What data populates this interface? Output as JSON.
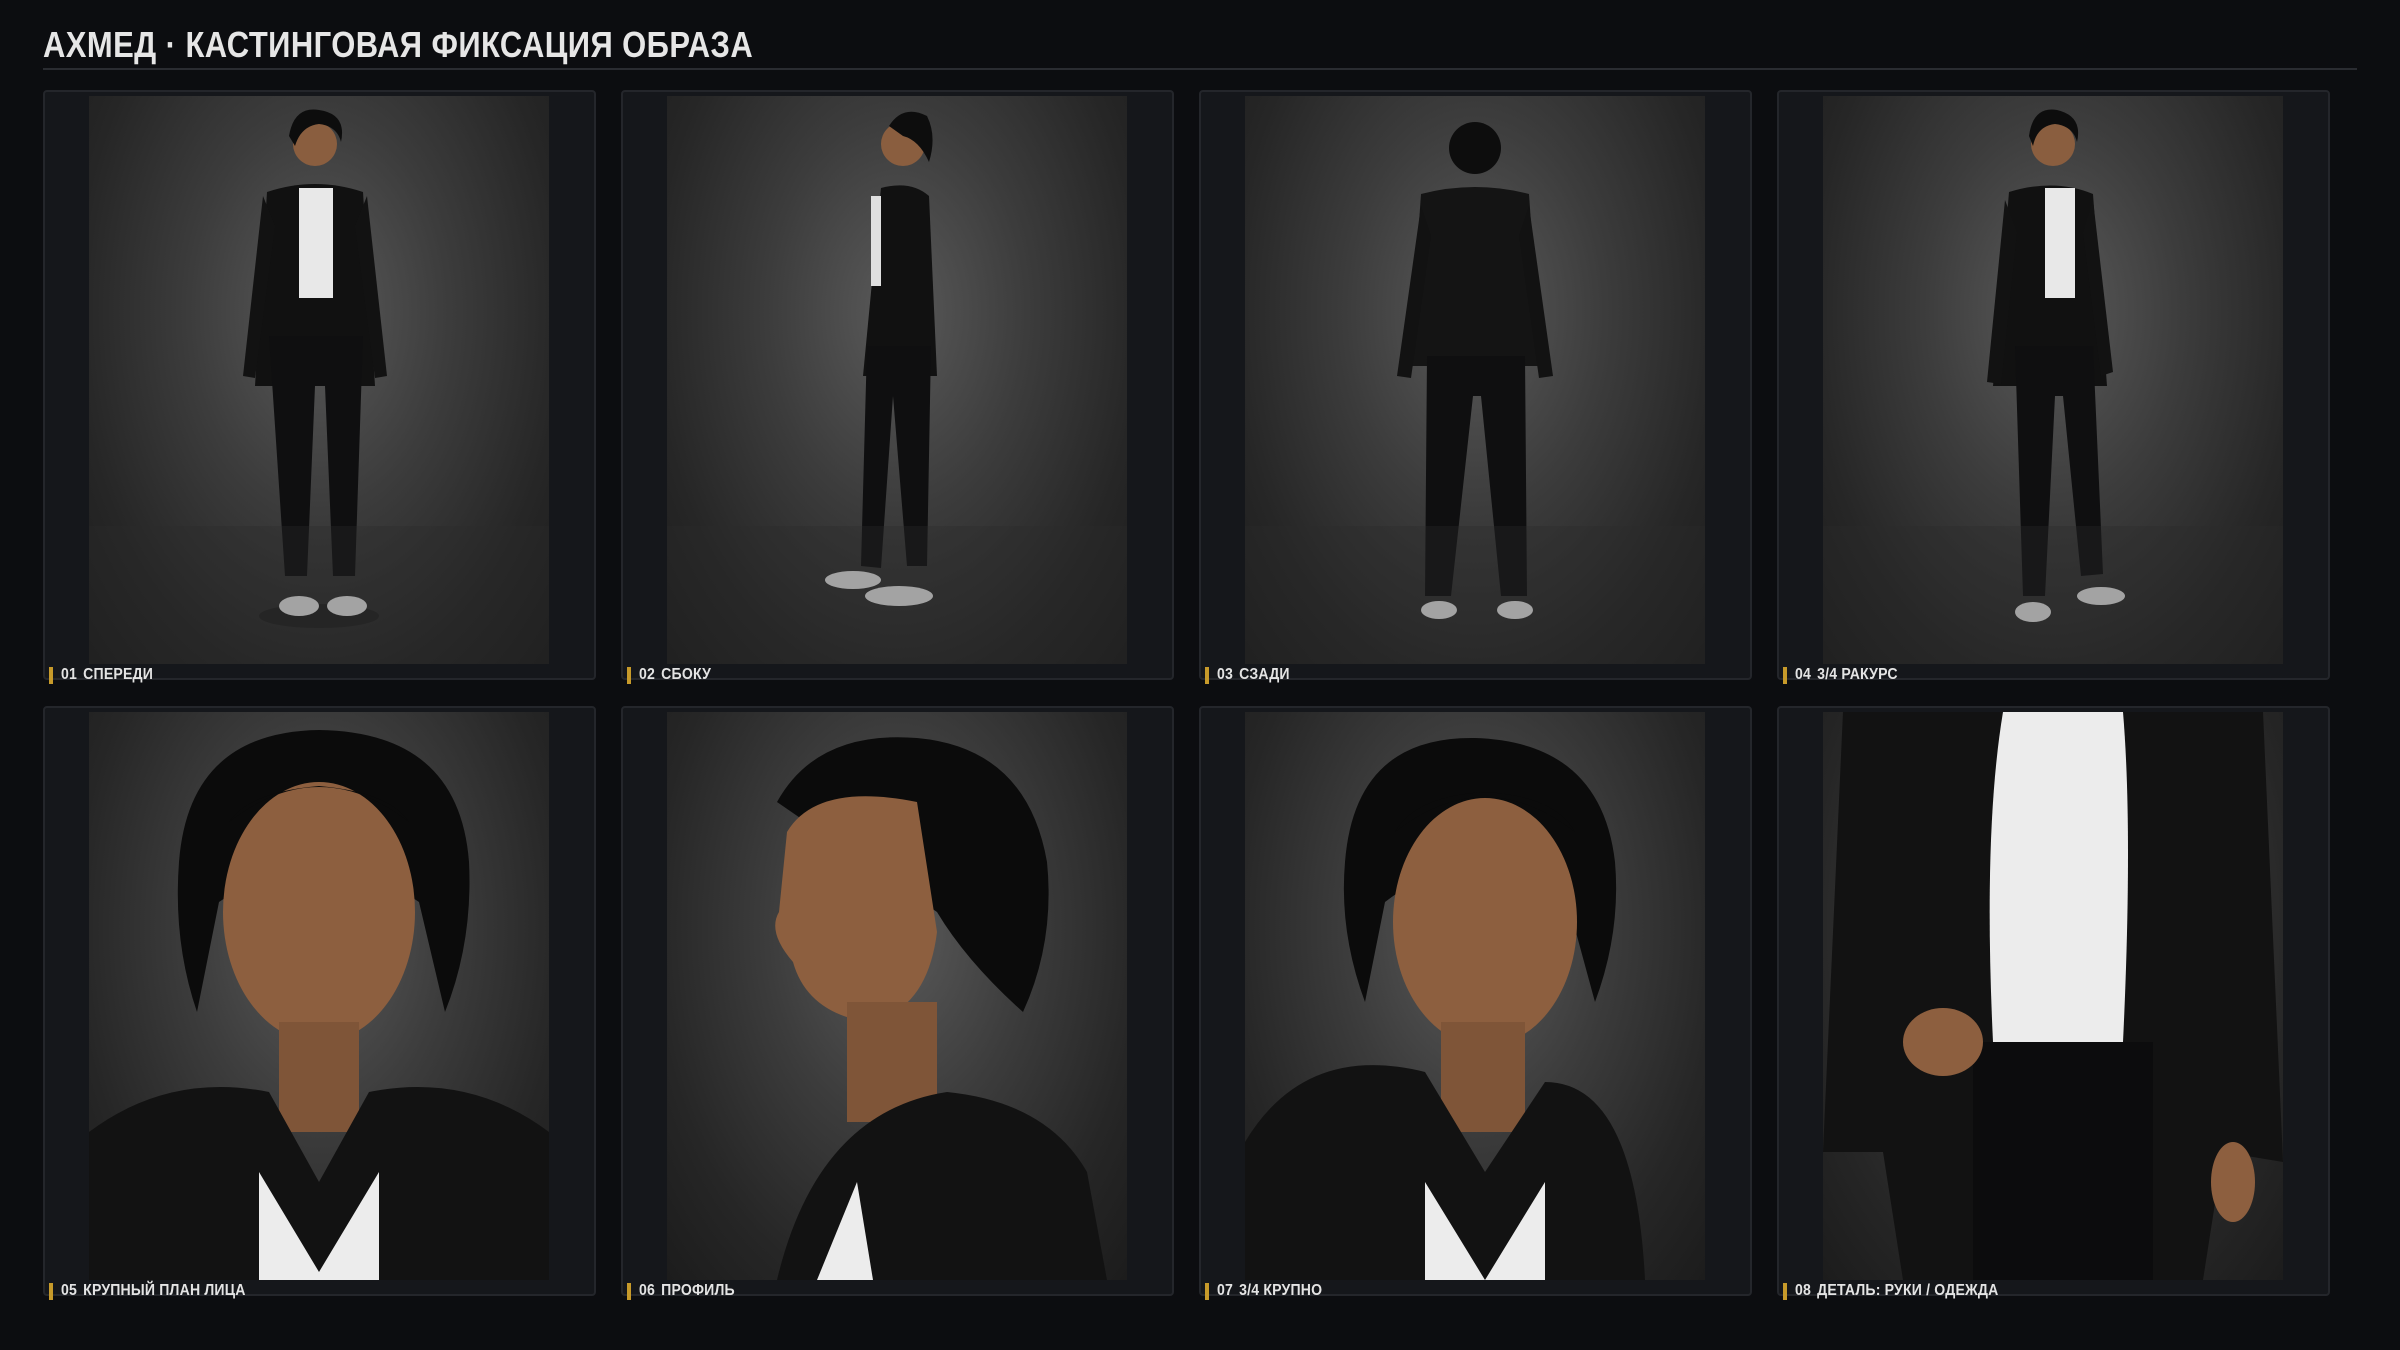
{
  "header": {
    "title": "АХМЕД · КАСТИНГОВАЯ ФИКСАЦИЯ ОБРАЗА"
  },
  "colors": {
    "background": "#0c0d10",
    "card": "#15171b",
    "accent": "#c79a2a",
    "text": "#e4e4e4"
  },
  "shots": [
    {
      "num": "01",
      "label": "СПЕРЕДИ",
      "view": "full-body-front"
    },
    {
      "num": "02",
      "label": "СБОКУ",
      "view": "full-body-side"
    },
    {
      "num": "03",
      "label": "СЗАДИ",
      "view": "full-body-back"
    },
    {
      "num": "04",
      "label": "3/4 РАКУРС",
      "view": "full-body-three-quarter"
    },
    {
      "num": "05",
      "label": "КРУПНЫЙ ПЛАН ЛИЦА",
      "view": "close-up-face"
    },
    {
      "num": "06",
      "label": "ПРОФИЛЬ",
      "view": "close-up-profile"
    },
    {
      "num": "07",
      "label": "3/4 КРУПНО",
      "view": "close-up-three-quarter"
    },
    {
      "num": "08",
      "label": "ДЕТАЛЬ: РУКИ / ОДЕЖДА",
      "view": "detail-hands-clothing"
    }
  ]
}
